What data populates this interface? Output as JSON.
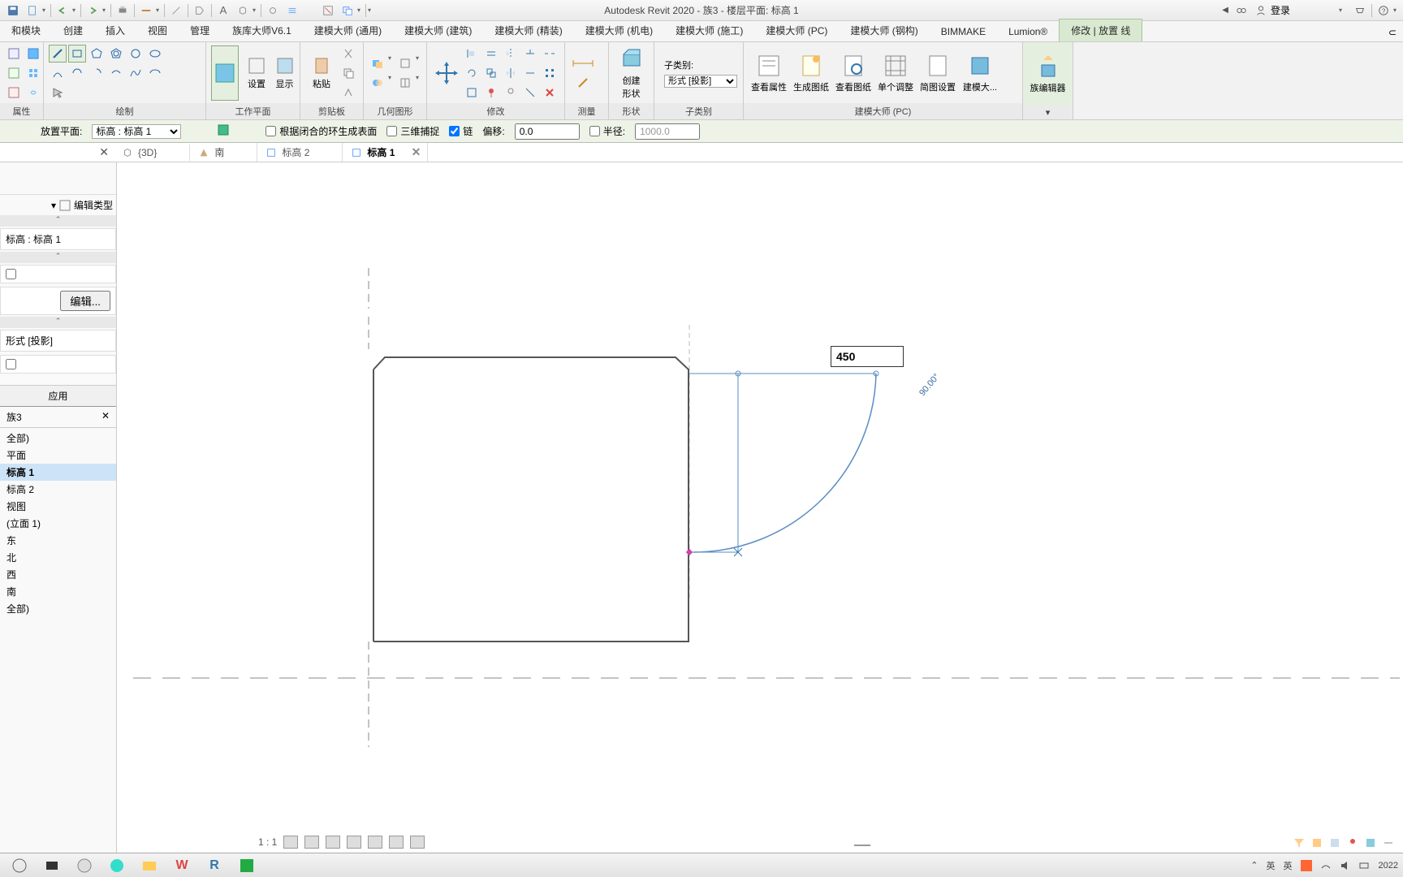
{
  "title": "Autodesk Revit 2020 - 族3 - 楼层平面: 标高 1",
  "login_label": "登录",
  "main_tabs": [
    "和模块",
    "创建",
    "插入",
    "视图",
    "管理",
    "族库大师V6.1",
    "建模大师 (通用)",
    "建模大师 (建筑)",
    "建模大师 (精装)",
    "建模大师 (机电)",
    "建模大师 (施工)",
    "建模大师 (PC)",
    "建模大师 (钢构)",
    "BIMMAKE",
    "Lumion®",
    "修改 | 放置 线"
  ],
  "main_tab_active": 15,
  "ribbon": {
    "groups": [
      "属性",
      "绘制",
      "工作平面",
      "剪贴板",
      "几何图形",
      "修改",
      "测量",
      "形状",
      "子类别",
      "建模大师 (PC)"
    ],
    "settings": "设置",
    "show": "显示",
    "paste": "粘贴",
    "create_shape": [
      "创建",
      "形状"
    ],
    "subcat_label": "子类别:",
    "subcat_value": "形式 [投影]",
    "view_attrs": "查看属性",
    "gen_sheet": "生成图纸",
    "view_sheet": "查看图纸",
    "single_adj": "单个调整",
    "simp_set": "简图设置",
    "model_master": "建模大...",
    "fam_editor": "族编辑器"
  },
  "options": {
    "place_plane_lbl": "放置平面:",
    "place_plane_val": "标高 : 标高 1",
    "gen_surface": "根据闭合的环生成表面",
    "snap3d": "三维捕捉",
    "chain": "链",
    "offset_lbl": "偏移:",
    "offset_val": "0.0",
    "radius_lbl": "半径:",
    "radius_val": "1000.0"
  },
  "view_tabs": [
    {
      "label": "{3D}"
    },
    {
      "label": "南"
    },
    {
      "label": "标高 2"
    },
    {
      "label": "标高 1",
      "active": true
    }
  ],
  "props": {
    "constraint": "标高 : 标高 1",
    "edit_btn": "编辑...",
    "edit_type": "编辑类型",
    "xing": "形式 [投影]",
    "apply": "应用"
  },
  "browser": {
    "title": "族3",
    "items": [
      "全部)",
      "平面",
      "标高 1",
      "标高 2",
      "视图",
      "(立面 1)",
      "东",
      "北",
      "西",
      "南",
      "全部)"
    ],
    "sel_index": 2
  },
  "canvas": {
    "input_val": "450",
    "angle": "90.00°",
    "scale": "1 : 1"
  },
  "taskbar": {
    "ime": "英",
    "time_frag": "2022"
  }
}
